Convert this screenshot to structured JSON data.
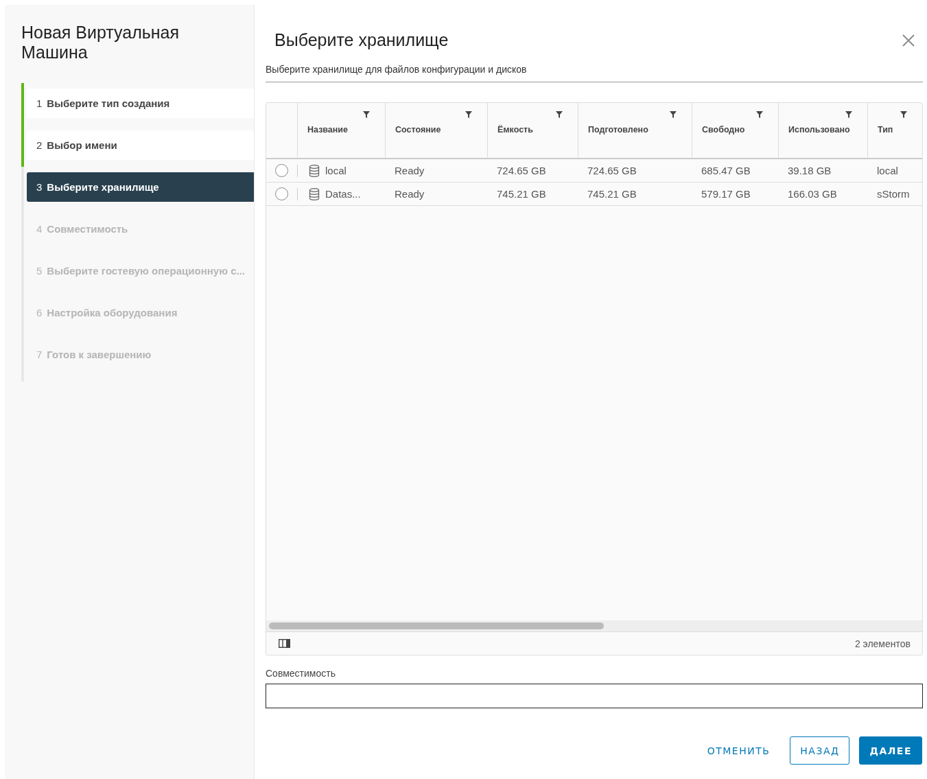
{
  "wizard": {
    "title": "Новая Виртуальная Машина",
    "steps": [
      {
        "number": "1",
        "label": "Выберите тип создания",
        "completed": true,
        "selected": false
      },
      {
        "number": "2",
        "label": "Выбор имени",
        "completed": true,
        "selected": false
      },
      {
        "number": "3",
        "label": "Выберите хранилище",
        "completed": false,
        "selected": true
      },
      {
        "number": "4",
        "label": "Совместимость",
        "completed": false,
        "selected": false
      },
      {
        "number": "5",
        "label": "Выберите гостевую операционную с...",
        "completed": false,
        "selected": false
      },
      {
        "number": "6",
        "label": "Настройка оборудования",
        "completed": false,
        "selected": false
      },
      {
        "number": "7",
        "label": "Готов к завершению",
        "completed": false,
        "selected": false
      }
    ]
  },
  "page": {
    "title": "Выберите хранилище",
    "subtitle": "Выберите хранилище для файлов конфигурации и дисков"
  },
  "table": {
    "columns": [
      "Название",
      "Состояние",
      "Ёмкость",
      "Подготовлено",
      "Свободно",
      "Использовано",
      "Тип"
    ],
    "rows": [
      {
        "selected": false,
        "cells": [
          "local",
          "Ready",
          "724.65 GB",
          "724.65 GB",
          "685.47 GB",
          "39.18 GB",
          "local"
        ]
      },
      {
        "selected": false,
        "cells": [
          "Datas...",
          "Ready",
          "745.21 GB",
          "745.21 GB",
          "579.17 GB",
          "166.03 GB",
          "sStorm"
        ]
      }
    ],
    "footer_count": "2 элементов"
  },
  "compatibility": {
    "label": "Совместимость"
  },
  "buttons": [
    {
      "kind": "flat",
      "label": "ОТМЕНИТЬ"
    },
    {
      "kind": "outline",
      "label": "НАЗАД"
    },
    {
      "kind": "primary",
      "label": "ДАЛЕЕ"
    }
  ]
}
